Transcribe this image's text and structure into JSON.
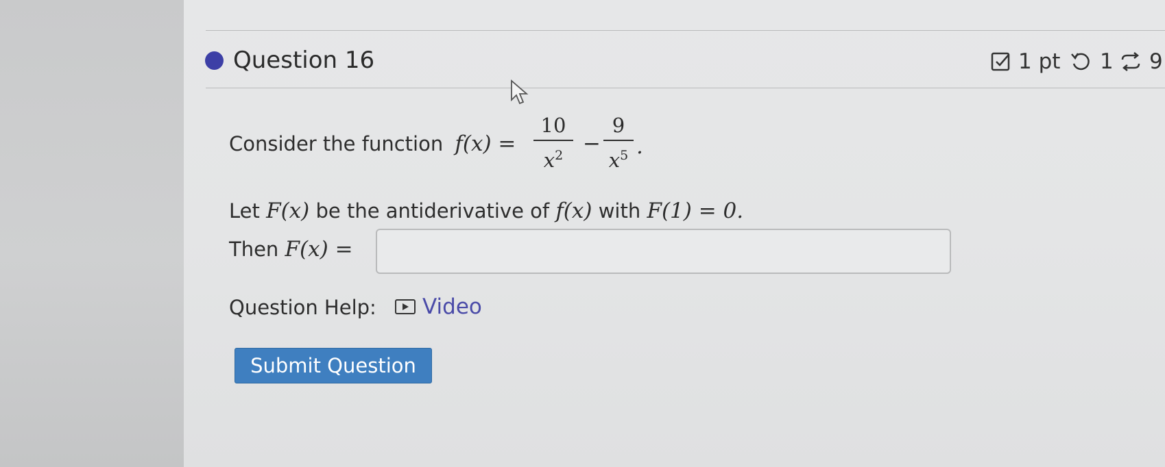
{
  "question": {
    "title": "Question 16",
    "points": "1 pt",
    "tries": "1",
    "regen_count": "9"
  },
  "problem": {
    "intro": "Consider the function",
    "fx": "f(x) =",
    "frac1_num": "10",
    "frac1_den": "x",
    "frac1_exp": "2",
    "minus": "−",
    "frac2_num": "9",
    "frac2_den": "x",
    "frac2_exp": "5",
    "period": ".",
    "let_prefix": "Let",
    "Fx": "F(x)",
    "let_mid": "be the antiderivative of",
    "fx2": "f(x)",
    "let_with": "with",
    "condition": "F(1) = 0.",
    "then_prefix": "Then",
    "then_expr": "F(x) ="
  },
  "answer": {
    "value": "",
    "placeholder": ""
  },
  "help": {
    "label": "Question Help:",
    "video_label": "Video"
  },
  "submit": {
    "label": "Submit Question"
  },
  "icons": {
    "points": "checkbox-icon",
    "tries": "retry-icon",
    "regen": "regenerate-icon",
    "video": "video-play-icon"
  },
  "colors": {
    "accent": "#3d3fa6",
    "button": "#3f7fc0",
    "link": "#4a4ba8"
  }
}
